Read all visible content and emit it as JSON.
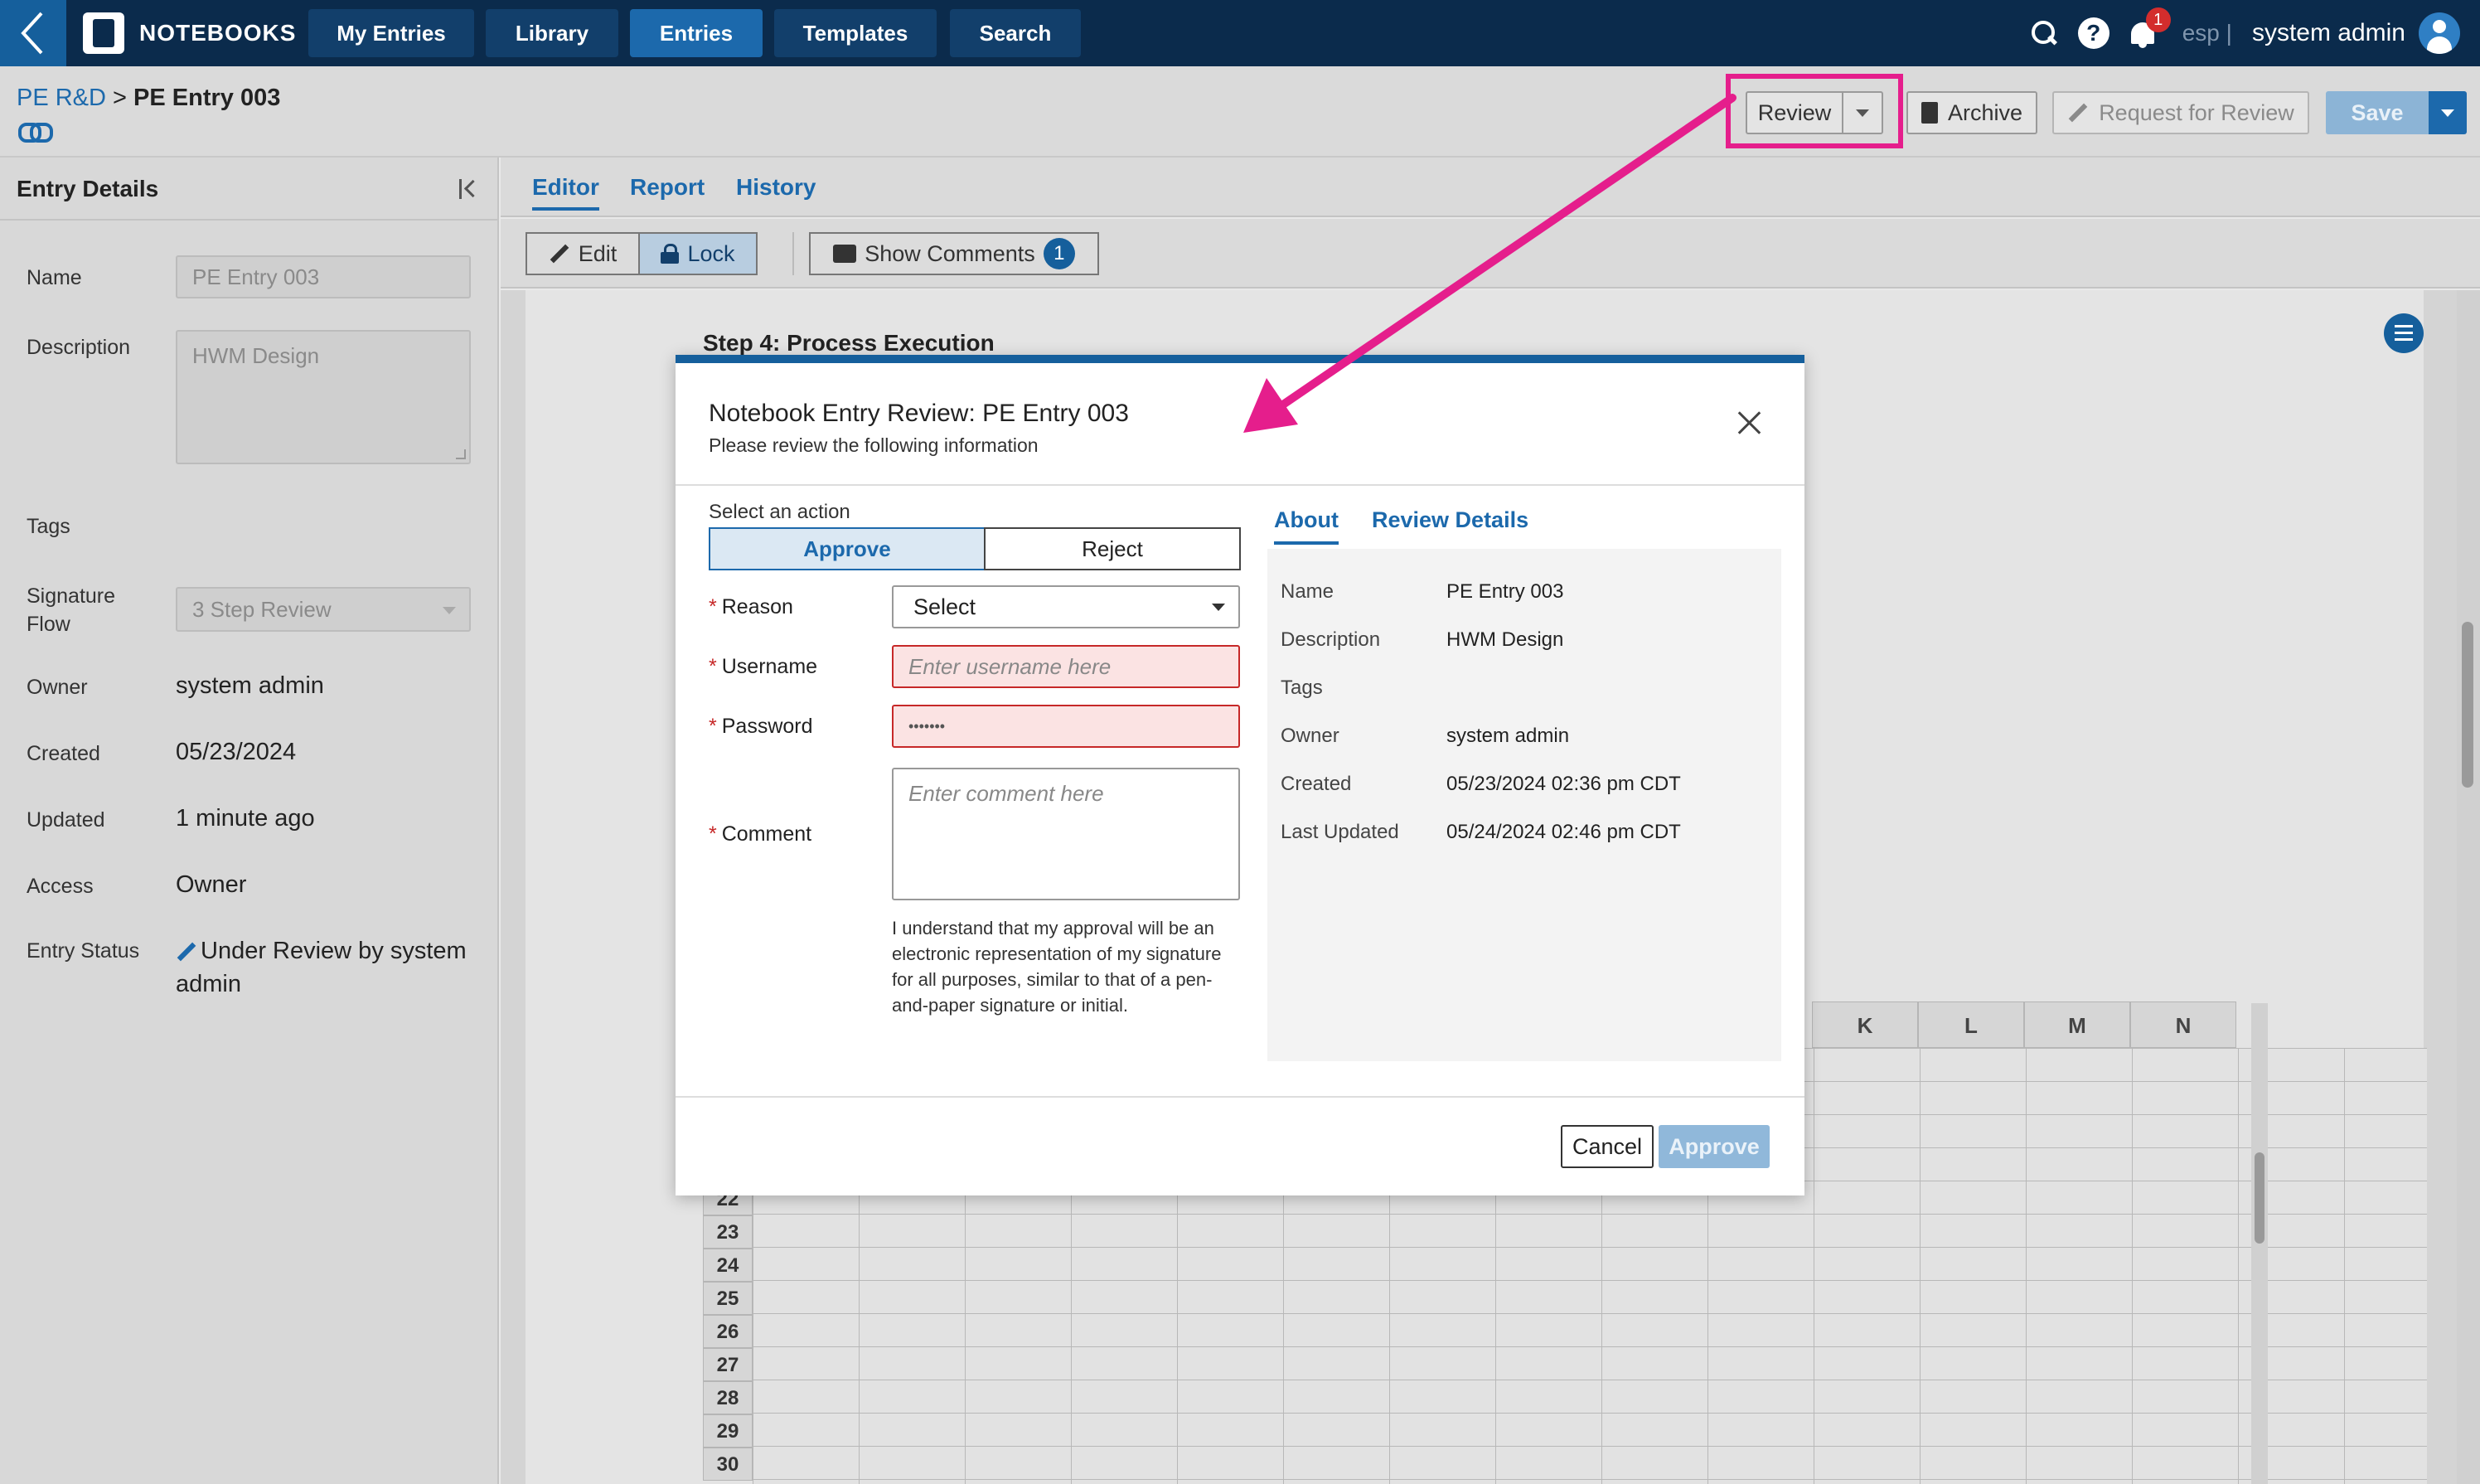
{
  "topnav": {
    "brand": "NOTEBOOKS",
    "tabs": [
      "My Entries",
      "Library",
      "Entries",
      "Templates",
      "Search"
    ],
    "active_tab": "Entries",
    "notification_count": "1",
    "lang": "esp |",
    "user": "system admin"
  },
  "breadcrumb": {
    "parent": "PE R&D",
    "separator": " > ",
    "current": "PE Entry 003"
  },
  "header_actions": {
    "review": "Review",
    "archive": "Archive",
    "request_review": "Request for Review",
    "save": "Save"
  },
  "entry_details": {
    "title": "Entry Details",
    "fields": {
      "name_label": "Name",
      "name_value": "PE Entry 003",
      "description_label": "Description",
      "description_value": "HWM Design",
      "tags_label": "Tags",
      "signature_flow_label": "Signature Flow",
      "signature_flow_value": "3 Step Review",
      "owner_label": "Owner",
      "owner_value": "system admin",
      "created_label": "Created",
      "created_value": "05/23/2024",
      "updated_label": "Updated",
      "updated_value": "1 minute ago",
      "access_label": "Access",
      "access_value": "Owner",
      "status_label": "Entry Status",
      "status_value": "Under Review by system admin"
    }
  },
  "main_tabs": [
    "Editor",
    "Report",
    "History"
  ],
  "toolbar": {
    "edit": "Edit",
    "lock": "Lock",
    "show_comments": "Show Comments",
    "comment_count": "1"
  },
  "document": {
    "step_title": "Step 4: Process Execution",
    "sheet_columns": [
      "K",
      "L",
      "M",
      "N"
    ],
    "sheet_rows": [
      "22",
      "23",
      "24",
      "25",
      "26",
      "27",
      "28",
      "29",
      "30"
    ]
  },
  "modal": {
    "title": "Notebook Entry Review: PE Entry 003",
    "subtitle": "Please review the following information",
    "select_action_label": "Select an action",
    "approve_option": "Approve",
    "reject_option": "Reject",
    "reason_label": "Reason",
    "reason_value": "Select",
    "username_label": "Username",
    "username_placeholder": "Enter username here",
    "password_label": "Password",
    "password_value": "•••••••",
    "comment_label": "Comment",
    "comment_placeholder": "Enter comment here",
    "disclaimer": "I understand that my approval will be an electronic representation of my signature for all purposes, similar to that of a pen-and-paper signature or initial.",
    "tabs": [
      "About",
      "Review Details"
    ],
    "about": {
      "name_label": "Name",
      "name_value": "PE Entry 003",
      "description_label": "Description",
      "description_value": "HWM Design",
      "tags_label": "Tags",
      "owner_label": "Owner",
      "owner_value": "system admin",
      "created_label": "Created",
      "created_value": "05/23/2024 02:36 pm CDT",
      "updated_label": "Last Updated",
      "updated_value": "05/24/2024 02:46 pm CDT"
    },
    "cancel": "Cancel",
    "approve": "Approve"
  },
  "annotation_color": "#e51e8c"
}
